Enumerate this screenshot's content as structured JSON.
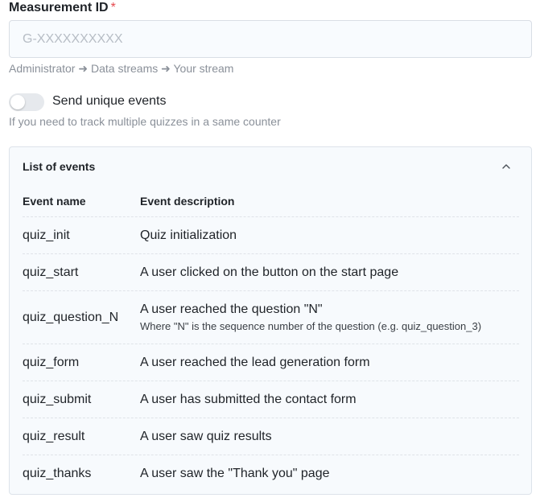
{
  "measurement": {
    "label": "Measurement ID",
    "required_mark": "*",
    "placeholder": "G-XXXXXXXXXX",
    "value": "",
    "hint": "Administrator ➜ Data streams ➜ Your stream"
  },
  "unique_events": {
    "label": "Send unique events",
    "enabled": false,
    "help": "If you need to track multiple quizzes in a same counter"
  },
  "events_panel": {
    "title": "List of events",
    "expanded": true,
    "chevron_icon": "chevron-up-icon",
    "columns": [
      "Event name",
      "Event description"
    ],
    "rows": [
      {
        "name": "quiz_init",
        "description": "Quiz initialization",
        "note": ""
      },
      {
        "name": "quiz_start",
        "description": "A user clicked on the button on the start page",
        "note": ""
      },
      {
        "name": "quiz_question_N",
        "description": "A user reached the question \"N\"",
        "note": "Where \"N\" is the sequence number of the question (e.g. quiz_question_3)"
      },
      {
        "name": "quiz_form",
        "description": "A user reached the lead generation form",
        "note": ""
      },
      {
        "name": "quiz_submit",
        "description": "A user has submitted the contact form",
        "note": ""
      },
      {
        "name": "quiz_result",
        "description": "A user saw quiz results",
        "note": ""
      },
      {
        "name": "quiz_thanks",
        "description": "A user saw the \"Thank you\" page",
        "note": ""
      }
    ]
  },
  "colors": {
    "required": "#e5484d",
    "muted_text": "#8a9099",
    "panel_bg": "#f7fafd",
    "input_bg": "#f8fbfe"
  }
}
